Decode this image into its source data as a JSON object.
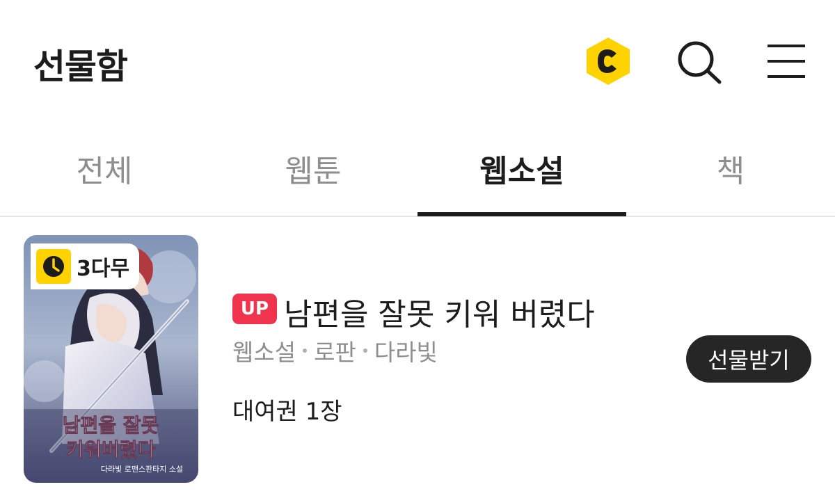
{
  "header": {
    "title": "선물함",
    "icons": [
      "cash-icon",
      "search-icon",
      "menu-icon"
    ],
    "cash_color": "#FFD200"
  },
  "tabs": [
    {
      "label": "전체",
      "active": false
    },
    {
      "label": "웹툰",
      "active": false
    },
    {
      "label": "웹소설",
      "active": true
    },
    {
      "label": "책",
      "active": false
    }
  ],
  "items": [
    {
      "wait_badge": "3다무",
      "up_badge": "UP",
      "title": "남편을 잘못 키워 버렸다",
      "meta": [
        "웹소설",
        "로판",
        "다라빛"
      ],
      "ticket": "대여권 1장",
      "action_label": "선물받기",
      "cover_title_lines": [
        "남편을 잘못",
        "키워버렸다"
      ],
      "cover_caption": "다라빛 로맨스판타지 소설"
    }
  ],
  "colors": {
    "up_badge": "#F0344D",
    "action_button": "#262626",
    "active_tab": "#1C1C1C",
    "inactive_tab": "#8E8E8E"
  }
}
